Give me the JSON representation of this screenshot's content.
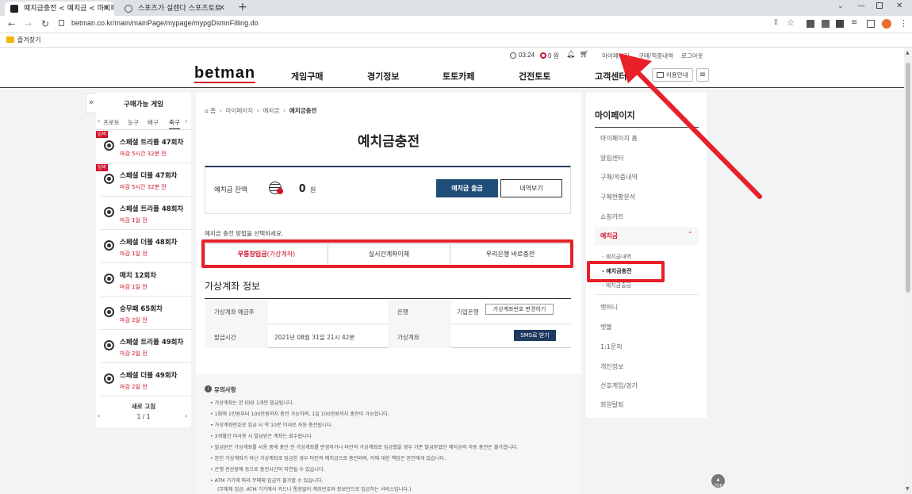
{
  "browser": {
    "tabs": [
      {
        "title": "예치금충전 < 예치금 < 마이페이지"
      },
      {
        "title": "스포츠가 설렌다 스포츠토토"
      }
    ],
    "new_tab": "+",
    "url": "betman.co.kr/main/mainPage/mypage/mypgDsmnFilling.do",
    "bookmark": "즐겨찾기"
  },
  "util": {
    "time": "03:24",
    "points": "0 원",
    "mypage": "마이페이지",
    "purchase": "구매/적중내역",
    "logout": "로그아웃"
  },
  "nav": {
    "logo": "betman",
    "items": [
      "게임구매",
      "경기정보",
      "토토카페",
      "건전토토",
      "고객센터"
    ],
    "guide": "이용안내"
  },
  "games_panel": {
    "title": "구매가능 게임",
    "sports": [
      "프로토",
      "농구",
      "배구",
      "축구"
    ],
    "items": [
      {
        "name": "스페셜 트리플 47회차",
        "deadline": "마감 5시간 32분 전",
        "badge": "임박"
      },
      {
        "name": "스페셜 더블 47회차",
        "deadline": "마감 5시간 32분 전",
        "badge": "임박"
      },
      {
        "name": "스페셜 트리플 48회차",
        "deadline": "마감 1일 전",
        "badge": ""
      },
      {
        "name": "스페셜 더블 48회차",
        "deadline": "마감 1일 전",
        "badge": ""
      },
      {
        "name": "매치 12회차",
        "deadline": "마감 1일 전",
        "badge": ""
      },
      {
        "name": "승무패 65회차",
        "deadline": "마감 2일 전",
        "badge": ""
      },
      {
        "name": "스페셜 트리플 49회차",
        "deadline": "마감 2일 전",
        "badge": ""
      },
      {
        "name": "스페셜 더블 49회차",
        "deadline": "마감 2일 전",
        "badge": ""
      }
    ],
    "refresh": "새로 고침",
    "pager": "1 / 1"
  },
  "main": {
    "breadcrumb": [
      "홈",
      "마이페이지",
      "예치금",
      "예치금충전"
    ],
    "title": "예치금충전",
    "balance_label": "예치금 잔액",
    "balance_value": "0",
    "balance_unit": "원",
    "withdraw_btn": "예치금 출금",
    "history_btn": "내역보기",
    "method_prompt": "예치금 충전 방법을 선택하세요.",
    "method_tabs": [
      {
        "label": "무통장입금",
        "sub": "(가상계좌)"
      },
      {
        "label": "실시간계좌이체",
        "sub": ""
      },
      {
        "label": "우리은행 바로충전",
        "sub": ""
      }
    ],
    "section_title": "가상계좌 정보",
    "table": {
      "holder_label": "가상계좌 예금주",
      "holder_value": "",
      "bank_label": "은행",
      "bank_value": "기업은행",
      "change_btn": "가상계좌번호 변경하기",
      "issued_label": "발급시간",
      "issued_value": "2021년 08월 31일 21시 42분",
      "account_label": "가상계좌",
      "sms_btn": "SMS로 받기"
    },
    "notes_title": "유의사항",
    "notes": [
      "가상계좌는 한 ID당 1개만 발급됩니다.",
      "1회에 1만원부터 100만원까지 충전 가능하며, 1일 100만원까지 충전이 가능합니다.",
      "가상계좌번호로 입금 시 약 10분 이내로 자동 충전됩니다.",
      "3개월간 미사용 시 발급받은 계좌는 회수됩니다.",
      "발급받은 가상계좌를 사용 중에 충전 전 가상계좌를 변경하거나 타인의 가상계좌로 입금했을 경우 기존 발급받았던 예치금의 자동 충전은 불가합니다.",
      "본인 가상계좌가 아닌 가상계좌로 입금한 경우 타인의 예치금으로 충전되며, 이에 대한 책임은 본인에게 있습니다.",
      "은행 전산장애 등으로 충전시간이 지연될 수 있습니다.",
      "ATM 기기에 따라 무매체 입금이 불가할 수 있습니다.",
      "(무매체 입금: ATM 기기에서 카드나 통장없이 계좌번호와 정보만으로 입금하는 서비스입니다.)"
    ]
  },
  "right_menu": {
    "title": "마이페이지",
    "items_top": [
      "마이페이지 홈",
      "알림센터",
      "구매/적중내역",
      "구매현황분석",
      "쇼핑카트"
    ],
    "active_group": "예치금",
    "sub_items": [
      "- 예치금내역",
      "- 예치금충전",
      "- 예치금출금"
    ],
    "items_bottom": [
      "벳머니",
      "벳볼",
      "1:1문의",
      "개인정보",
      "선호게임/경기",
      "회원탈퇴"
    ]
  },
  "top_btn": "TOP",
  "colors": {
    "accent_red": "#d0132a",
    "navy": "#1f4e79",
    "annotation_red": "#e8202a"
  }
}
